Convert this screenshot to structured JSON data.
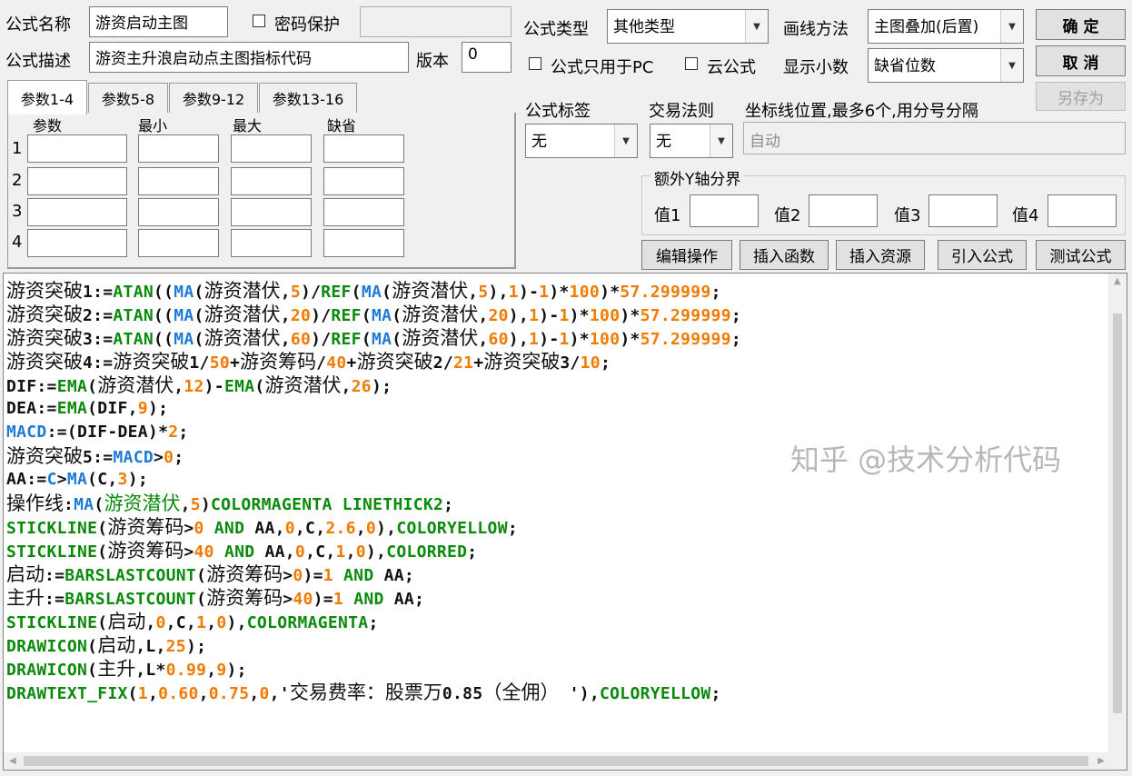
{
  "header": {
    "name_label": "公式名称",
    "name_value": "游资启动主图",
    "password_label": "密码保护",
    "password_value": "",
    "desc_label": "公式描述",
    "desc_value": "游资主升浪启动点主图指标代码",
    "version_label": "版本",
    "version_value": "0"
  },
  "tabs": [
    "参数1-4",
    "参数5-8",
    "参数9-12",
    "参数13-16"
  ],
  "params": {
    "headers": [
      "参数",
      "最小",
      "最大",
      "缺省"
    ],
    "rows": [
      "1",
      "2",
      "3",
      "4"
    ]
  },
  "right": {
    "type_label": "公式类型",
    "type_value": "其他类型",
    "draw_label": "画线方法",
    "draw_value": "主图叠加(后置)",
    "pc_only_label": "公式只用于PC",
    "cloud_label": "云公式",
    "decimal_label": "显示小数",
    "decimal_value": "缺省位数",
    "tag_label": "公式标签",
    "tag_value": "无",
    "rule_label": "交易法则",
    "rule_value": "无",
    "axis_label": "坐标线位置,最多6个,用分号分隔",
    "axis_value": "自动",
    "ybound_title": "额外Y轴分界",
    "ybound_labels": [
      "值1",
      "值2",
      "值3",
      "值4"
    ]
  },
  "buttons": {
    "ok": "确  定",
    "cancel": "取  消",
    "save_as": "另存为",
    "edit": "编辑操作",
    "insert_func": "插入函数",
    "insert_res": "插入资源",
    "import": "引入公式",
    "test": "测试公式"
  },
  "code_lines": [
    [
      [
        "游资突破",
        "cn"
      ],
      [
        "1:=",
        "def"
      ],
      [
        "ATAN",
        "fn"
      ],
      [
        "((",
        "def"
      ],
      [
        "MA",
        "var"
      ],
      [
        "(",
        "def"
      ],
      [
        "游资潜伏",
        "cn"
      ],
      [
        ",",
        "def"
      ],
      [
        "5",
        "num"
      ],
      [
        ")/",
        "def"
      ],
      [
        "REF",
        "fn"
      ],
      [
        "(",
        "def"
      ],
      [
        "MA",
        "var"
      ],
      [
        "(",
        "def"
      ],
      [
        "游资潜伏",
        "cn"
      ],
      [
        ",",
        "def"
      ],
      [
        "5",
        "num"
      ],
      [
        "),",
        "def"
      ],
      [
        "1",
        "num"
      ],
      [
        ")-",
        "def"
      ],
      [
        "1",
        "num"
      ],
      [
        ")*",
        "def"
      ],
      [
        "100",
        "num"
      ],
      [
        ")*",
        "def"
      ],
      [
        "57.299999",
        "num"
      ],
      [
        ";",
        "def"
      ]
    ],
    [
      [
        "游资突破",
        "cn"
      ],
      [
        "2:=",
        "def"
      ],
      [
        "ATAN",
        "fn"
      ],
      [
        "((",
        "def"
      ],
      [
        "MA",
        "var"
      ],
      [
        "(",
        "def"
      ],
      [
        "游资潜伏",
        "cn"
      ],
      [
        ",",
        "def"
      ],
      [
        "20",
        "num"
      ],
      [
        ")/",
        "def"
      ],
      [
        "REF",
        "fn"
      ],
      [
        "(",
        "def"
      ],
      [
        "MA",
        "var"
      ],
      [
        "(",
        "def"
      ],
      [
        "游资潜伏",
        "cn"
      ],
      [
        ",",
        "def"
      ],
      [
        "20",
        "num"
      ],
      [
        "),",
        "def"
      ],
      [
        "1",
        "num"
      ],
      [
        ")-",
        "def"
      ],
      [
        "1",
        "num"
      ],
      [
        ")*",
        "def"
      ],
      [
        "100",
        "num"
      ],
      [
        ")*",
        "def"
      ],
      [
        "57.299999",
        "num"
      ],
      [
        ";",
        "def"
      ]
    ],
    [
      [
        "游资突破",
        "cn"
      ],
      [
        "3:=",
        "def"
      ],
      [
        "ATAN",
        "fn"
      ],
      [
        "((",
        "def"
      ],
      [
        "MA",
        "var"
      ],
      [
        "(",
        "def"
      ],
      [
        "游资潜伏",
        "cn"
      ],
      [
        ",",
        "def"
      ],
      [
        "60",
        "num"
      ],
      [
        ")/",
        "def"
      ],
      [
        "REF",
        "fn"
      ],
      [
        "(",
        "def"
      ],
      [
        "MA",
        "var"
      ],
      [
        "(",
        "def"
      ],
      [
        "游资潜伏",
        "cn"
      ],
      [
        ",",
        "def"
      ],
      [
        "60",
        "num"
      ],
      [
        "),",
        "def"
      ],
      [
        "1",
        "num"
      ],
      [
        ")-",
        "def"
      ],
      [
        "1",
        "num"
      ],
      [
        ")*",
        "def"
      ],
      [
        "100",
        "num"
      ],
      [
        ")*",
        "def"
      ],
      [
        "57.299999",
        "num"
      ],
      [
        ";",
        "def"
      ]
    ],
    [
      [
        "游资突破",
        "cn"
      ],
      [
        "4:=",
        "def"
      ],
      [
        "游资突破",
        "cn"
      ],
      [
        "1/",
        "def"
      ],
      [
        "50",
        "num"
      ],
      [
        "+",
        "def"
      ],
      [
        "游资筹码",
        "cn"
      ],
      [
        "/",
        "def"
      ],
      [
        "40",
        "num"
      ],
      [
        "+",
        "def"
      ],
      [
        "游资突破",
        "cn"
      ],
      [
        "2/",
        "def"
      ],
      [
        "21",
        "num"
      ],
      [
        "+",
        "def"
      ],
      [
        "游资突破",
        "cn"
      ],
      [
        "3/",
        "def"
      ],
      [
        "10",
        "num"
      ],
      [
        ";",
        "def"
      ]
    ],
    [
      [
        "DIF:=",
        "def"
      ],
      [
        "EMA",
        "fn"
      ],
      [
        "(",
        "def"
      ],
      [
        "游资潜伏",
        "cn"
      ],
      [
        ",",
        "def"
      ],
      [
        "12",
        "num"
      ],
      [
        ")-",
        "def"
      ],
      [
        "EMA",
        "fn"
      ],
      [
        "(",
        "def"
      ],
      [
        "游资潜伏",
        "cn"
      ],
      [
        ",",
        "def"
      ],
      [
        "26",
        "num"
      ],
      [
        ");",
        "def"
      ]
    ],
    [
      [
        "DEA:=",
        "def"
      ],
      [
        "EMA",
        "fn"
      ],
      [
        "(DIF,",
        "def"
      ],
      [
        "9",
        "num"
      ],
      [
        ");",
        "def"
      ]
    ],
    [
      [
        "MACD",
        "var"
      ],
      [
        ":=(DIF-DEA)*",
        "def"
      ],
      [
        "2",
        "num"
      ],
      [
        ";",
        "def"
      ]
    ],
    [
      [
        "游资突破",
        "cn"
      ],
      [
        "5:=",
        "def"
      ],
      [
        "MACD",
        "var"
      ],
      [
        ">",
        "def"
      ],
      [
        "0",
        "num"
      ],
      [
        ";",
        "def"
      ]
    ],
    [
      [
        "AA:=",
        "def"
      ],
      [
        "C",
        "var"
      ],
      [
        ">",
        "def"
      ],
      [
        "MA",
        "var"
      ],
      [
        "(C,",
        "def"
      ],
      [
        "3",
        "num"
      ],
      [
        ");",
        "def"
      ]
    ],
    [
      [
        "操作线",
        "cn"
      ],
      [
        ":",
        "def"
      ],
      [
        "MA",
        "var"
      ],
      [
        "(",
        "def"
      ],
      [
        "游资潜伏",
        "cng"
      ],
      [
        ",",
        "def"
      ],
      [
        "5",
        "num"
      ],
      [
        ")",
        "def"
      ],
      [
        "COLORMAGENTA LINETHICK2",
        "fn"
      ],
      [
        ";",
        "def"
      ]
    ],
    [
      [
        "STICKLINE",
        "fn"
      ],
      [
        "(",
        "def"
      ],
      [
        "游资筹码",
        "cn"
      ],
      [
        ">",
        "def"
      ],
      [
        "0",
        "num"
      ],
      [
        " ",
        "def"
      ],
      [
        "AND",
        "kw"
      ],
      [
        " AA,",
        "def"
      ],
      [
        "0",
        "num"
      ],
      [
        ",C,",
        "def"
      ],
      [
        "2.6",
        "num"
      ],
      [
        ",",
        "def"
      ],
      [
        "0",
        "num"
      ],
      [
        "),",
        "def"
      ],
      [
        "COLORYELLOW",
        "fn"
      ],
      [
        ";",
        "def"
      ]
    ],
    [
      [
        "STICKLINE",
        "fn"
      ],
      [
        "(",
        "def"
      ],
      [
        "游资筹码",
        "cn"
      ],
      [
        ">",
        "def"
      ],
      [
        "40",
        "num"
      ],
      [
        " ",
        "def"
      ],
      [
        "AND",
        "kw"
      ],
      [
        " AA,",
        "def"
      ],
      [
        "0",
        "num"
      ],
      [
        ",C,",
        "def"
      ],
      [
        "1",
        "num"
      ],
      [
        ",",
        "def"
      ],
      [
        "0",
        "num"
      ],
      [
        "),",
        "def"
      ],
      [
        "COLORRED",
        "fn"
      ],
      [
        ";",
        "def"
      ]
    ],
    [
      [
        "启动",
        "cn"
      ],
      [
        ":=",
        "def"
      ],
      [
        "BARSLASTCOUNT",
        "fn"
      ],
      [
        "(",
        "def"
      ],
      [
        "游资筹码",
        "cn"
      ],
      [
        ">",
        "def"
      ],
      [
        "0",
        "num"
      ],
      [
        ")=",
        "def"
      ],
      [
        "1",
        "num"
      ],
      [
        " ",
        "def"
      ],
      [
        "AND",
        "kw"
      ],
      [
        " AA;",
        "def"
      ]
    ],
    [
      [
        "主升",
        "cn"
      ],
      [
        ":=",
        "def"
      ],
      [
        "BARSLASTCOUNT",
        "fn"
      ],
      [
        "(",
        "def"
      ],
      [
        "游资筹码",
        "cn"
      ],
      [
        ">",
        "def"
      ],
      [
        "40",
        "num"
      ],
      [
        ")=",
        "def"
      ],
      [
        "1",
        "num"
      ],
      [
        " ",
        "def"
      ],
      [
        "AND",
        "kw"
      ],
      [
        " AA;",
        "def"
      ]
    ],
    [
      [
        "STICKLINE",
        "fn"
      ],
      [
        "(",
        "def"
      ],
      [
        "启动",
        "cn"
      ],
      [
        ",",
        "def"
      ],
      [
        "0",
        "num"
      ],
      [
        ",C,",
        "def"
      ],
      [
        "1",
        "num"
      ],
      [
        ",",
        "def"
      ],
      [
        "0",
        "num"
      ],
      [
        "),",
        "def"
      ],
      [
        "COLORMAGENTA",
        "fn"
      ],
      [
        ";",
        "def"
      ]
    ],
    [
      [
        "DRAWICON",
        "fn"
      ],
      [
        "(",
        "def"
      ],
      [
        "启动",
        "cn"
      ],
      [
        ",L,",
        "def"
      ],
      [
        "25",
        "num"
      ],
      [
        ");",
        "def"
      ]
    ],
    [
      [
        "DRAWICON",
        "fn"
      ],
      [
        "(",
        "def"
      ],
      [
        "主升",
        "cn"
      ],
      [
        ",L*",
        "def"
      ],
      [
        "0.99",
        "num"
      ],
      [
        ",",
        "def"
      ],
      [
        "9",
        "num"
      ],
      [
        ");",
        "def"
      ]
    ],
    [
      [
        "DRAWTEXT_FIX",
        "fn"
      ],
      [
        "(",
        "def"
      ],
      [
        "1",
        "num"
      ],
      [
        ",",
        "def"
      ],
      [
        "0.60",
        "num"
      ],
      [
        ",",
        "def"
      ],
      [
        "0.75",
        "num"
      ],
      [
        ",",
        "def"
      ],
      [
        "0",
        "num"
      ],
      [
        ",'",
        "def"
      ],
      [
        "交易费率：股票万",
        "cn"
      ],
      [
        "0.85",
        "def"
      ],
      [
        "（全佣）",
        "cn"
      ],
      [
        " '),",
        "def"
      ],
      [
        "COLORYELLOW",
        "fn"
      ],
      [
        ";",
        "def"
      ]
    ]
  ],
  "watermark": "知乎 @技术分析代码",
  "colors": {
    "function": "#0a8a0a",
    "variable": "#1e7ad6",
    "number": "#f07b00",
    "default": "#111111"
  }
}
